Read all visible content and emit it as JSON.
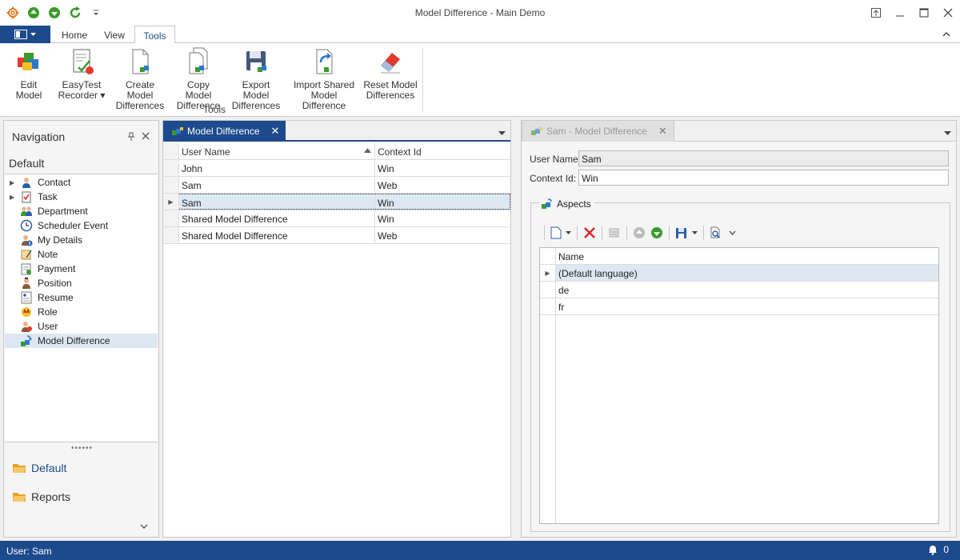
{
  "window": {
    "title": "Model Difference - Main Demo"
  },
  "ribbon": {
    "tabs": [
      "Home",
      "View",
      "Tools"
    ],
    "active_tab": "Tools",
    "buttons": [
      {
        "line1": "Edit Model",
        "line2": ""
      },
      {
        "line1": "EasyTest",
        "line2": "Recorder ▾"
      },
      {
        "line1": "Create Model",
        "line2": "Differences"
      },
      {
        "line1": "Copy Model",
        "line2": "Difference"
      },
      {
        "line1": "Export Model",
        "line2": "Differences"
      },
      {
        "line1": "Import Shared",
        "line2": "Model Difference"
      },
      {
        "line1": "Reset Model",
        "line2": "Differences"
      }
    ],
    "group_label": "Tools"
  },
  "navigation": {
    "title": "Navigation",
    "group_default": "Default",
    "items": [
      {
        "label": "Contact",
        "icon": "contact-icon",
        "expandable": "▶"
      },
      {
        "label": "Task",
        "icon": "task-icon",
        "expandable": "▶"
      },
      {
        "label": "Department",
        "icon": "department-icon",
        "expandable": ""
      },
      {
        "label": "Scheduler Event",
        "icon": "clock-icon",
        "expandable": ""
      },
      {
        "label": "My Details",
        "icon": "my-details-icon",
        "expandable": ""
      },
      {
        "label": "Note",
        "icon": "note-icon",
        "expandable": ""
      },
      {
        "label": "Payment",
        "icon": "payment-icon",
        "expandable": ""
      },
      {
        "label": "Position",
        "icon": "position-icon",
        "expandable": ""
      },
      {
        "label": "Resume",
        "icon": "resume-icon",
        "expandable": ""
      },
      {
        "label": "Role",
        "icon": "role-icon",
        "expandable": ""
      },
      {
        "label": "User",
        "icon": "user-icon",
        "expandable": ""
      },
      {
        "label": "Model Difference",
        "icon": "model-difference-icon",
        "expandable": ""
      }
    ],
    "selected_item": "Model Difference",
    "groups": [
      "Default",
      "Reports"
    ]
  },
  "list_view": {
    "tab_title": "Model Difference",
    "columns": [
      "User Name",
      "Context Id"
    ],
    "rows": [
      {
        "user": "John",
        "context": "Win"
      },
      {
        "user": "Sam",
        "context": "Web"
      },
      {
        "user": "Sam",
        "context": "Win"
      },
      {
        "user": "Shared Model Difference",
        "context": "Win"
      },
      {
        "user": "Shared Model Difference",
        "context": "Web"
      }
    ],
    "focused_row": 2
  },
  "detail_view": {
    "tab_title": "Sam - Model Difference",
    "user_name_label": "User Name:",
    "user_name_value": "Sam",
    "context_id_label": "Context Id:",
    "context_id_value": "Win",
    "aspects_title": "Aspects",
    "aspects_column": "Name",
    "aspects": [
      "(Default language)",
      "de",
      "fr"
    ]
  },
  "status": {
    "user": "User: Sam",
    "notifications": "0"
  },
  "colors": {
    "accent": "#1c4a8c",
    "selection": "#dde8f3"
  }
}
